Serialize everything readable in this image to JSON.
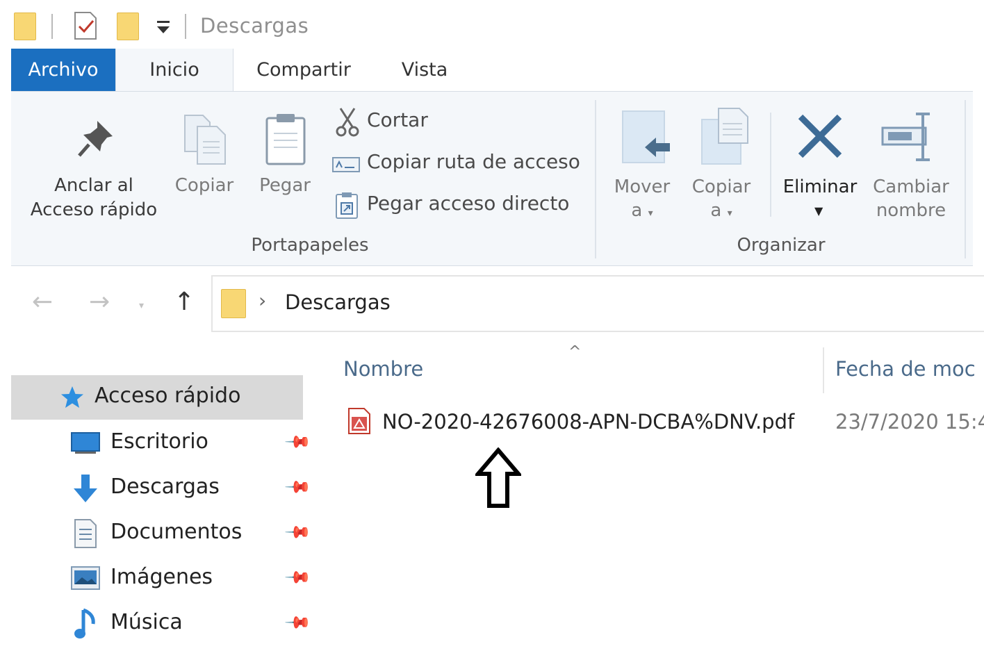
{
  "window": {
    "title": "Descargas"
  },
  "ribbon_tabs": [
    {
      "label": "Archivo"
    },
    {
      "label": "Inicio"
    },
    {
      "label": "Compartir"
    },
    {
      "label": "Vista"
    }
  ],
  "ribbon": {
    "clipboard": {
      "pin_line1": "Anclar al",
      "pin_line2": "Acceso rápido",
      "copy": "Copiar",
      "paste": "Pegar",
      "cut": "Cortar",
      "copy_path": "Copiar ruta de acceso",
      "paste_shortcut": "Pegar acceso directo",
      "group_label": "Portapapeles"
    },
    "organize": {
      "move_line1": "Mover",
      "move_line2": "a",
      "copy_line1": "Copiar",
      "copy_line2": "a",
      "delete": "Eliminar",
      "rename_line1": "Cambiar",
      "rename_line2": "nombre",
      "group_label": "Organizar"
    }
  },
  "address_bar": {
    "separator": "›",
    "crumb": "Descargas"
  },
  "navigation_pane": {
    "quick_access": "Acceso rápido",
    "items": [
      {
        "label": "Escritorio",
        "icon": "desktop-icon"
      },
      {
        "label": "Descargas",
        "icon": "downloads-icon"
      },
      {
        "label": "Documentos",
        "icon": "documents-icon"
      },
      {
        "label": "Imágenes",
        "icon": "pictures-icon"
      },
      {
        "label": "Música",
        "icon": "music-icon"
      }
    ]
  },
  "file_list": {
    "columns": [
      "Nombre",
      "Fecha de moc"
    ],
    "rows": [
      {
        "name": "NO-2020-42676008-APN-DCBA%DNV.pdf",
        "date": "23/7/2020 15:4",
        "icon": "pdf-icon"
      }
    ]
  },
  "colors": {
    "accent": "#1b6fc0",
    "folder": "#f8d774",
    "selection": "#d9d9d9"
  }
}
